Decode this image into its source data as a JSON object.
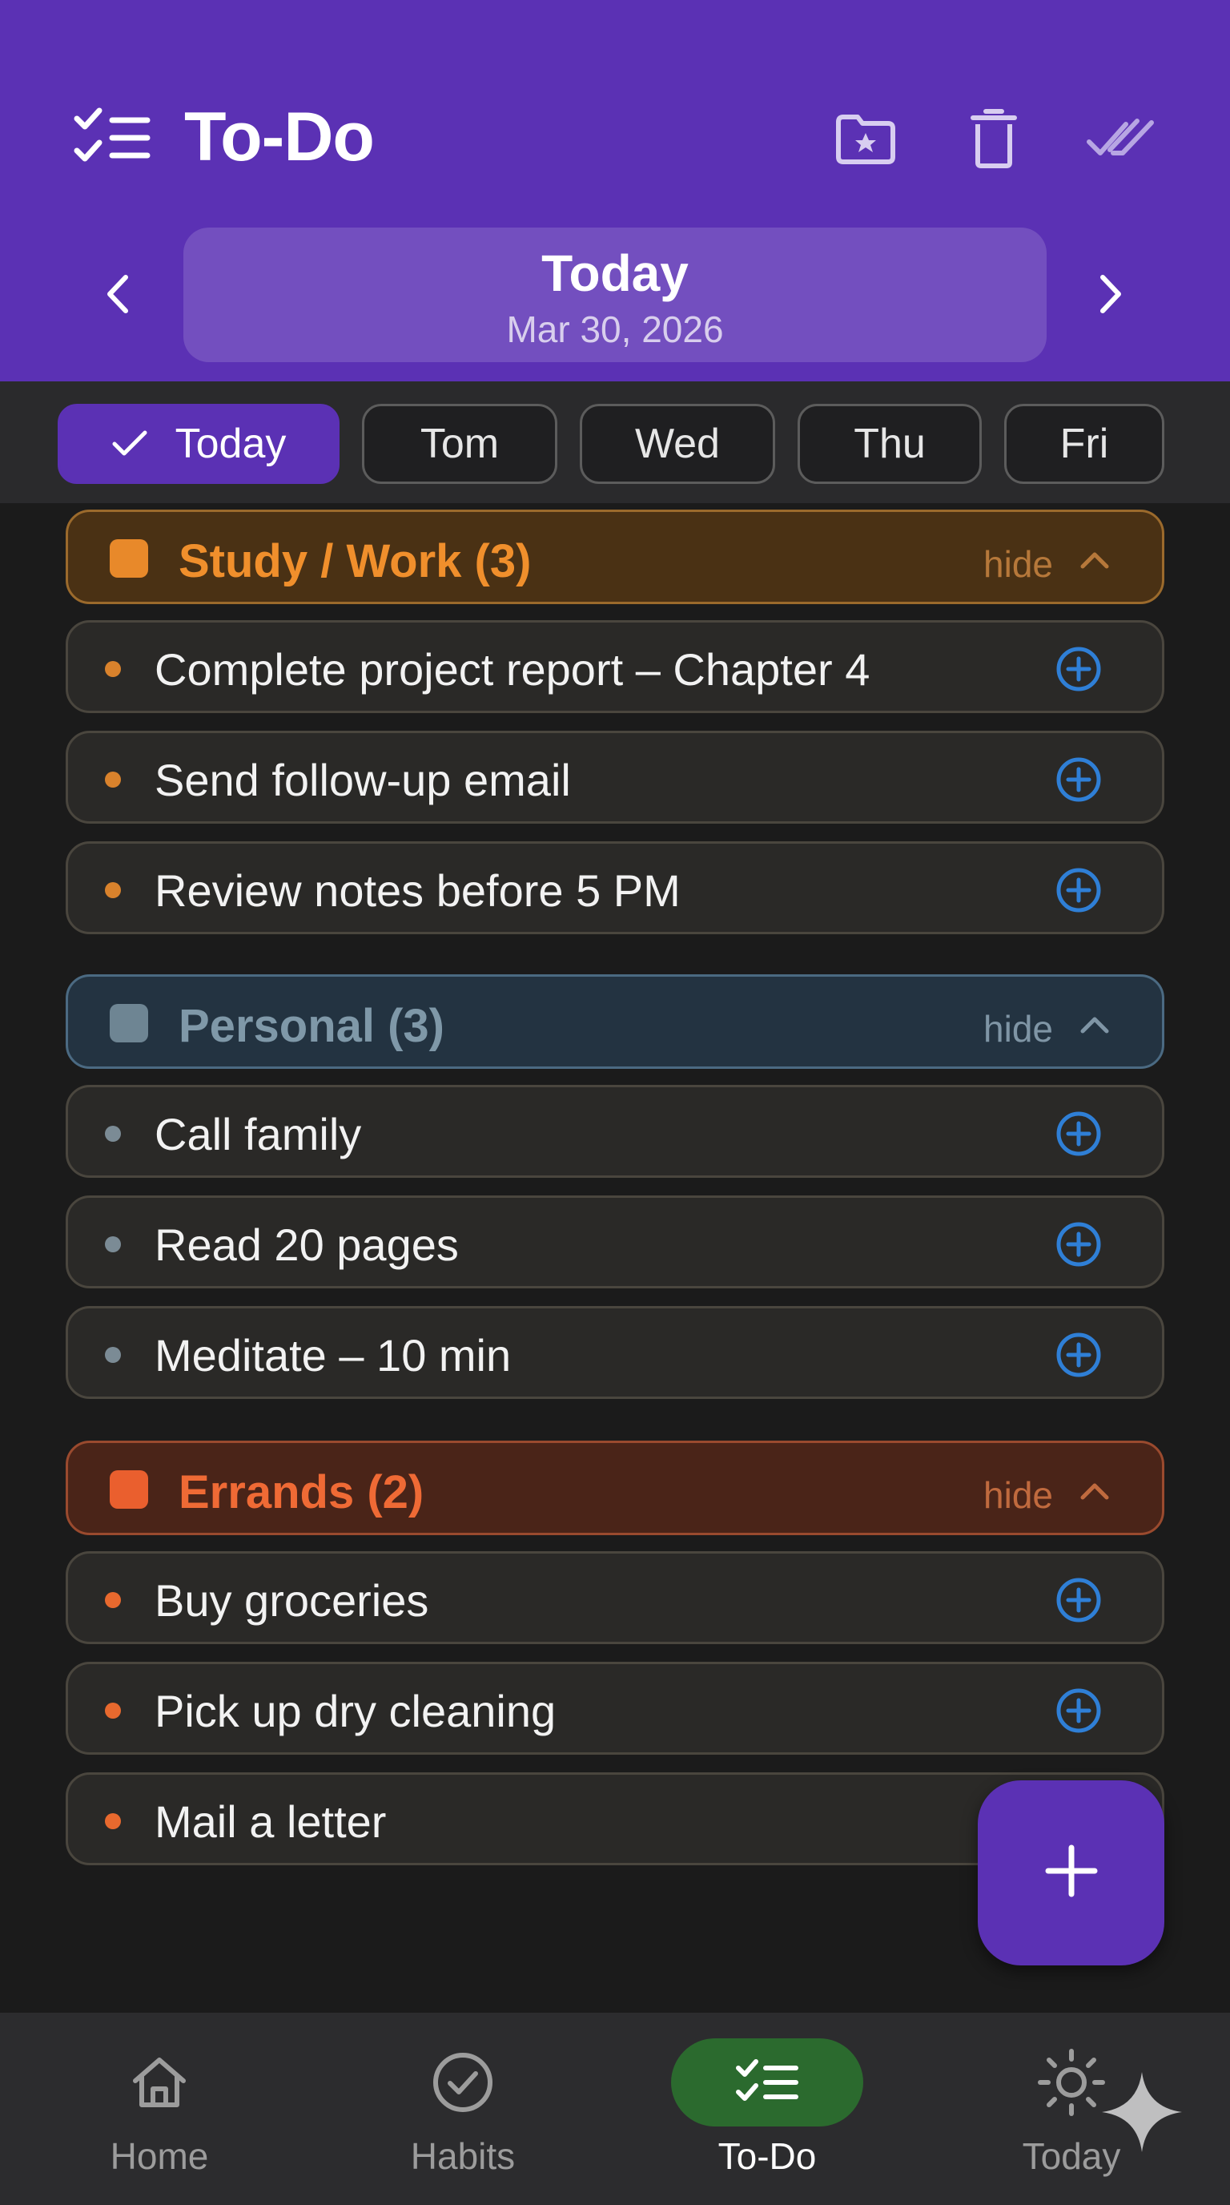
{
  "header": {
    "title": "To-Do",
    "date_label": "Today",
    "date_sub": "Mar 30, 2026",
    "actions": [
      "starred-folder-icon",
      "trash-icon",
      "mark-all-done-icon"
    ]
  },
  "days": [
    {
      "label": "Today",
      "active": true
    },
    {
      "label": "Tom",
      "active": false
    },
    {
      "label": "Wed",
      "active": false
    },
    {
      "label": "Thu",
      "active": false
    },
    {
      "label": "Fri",
      "active": false
    }
  ],
  "groups": [
    {
      "title": "Study / Work (3)",
      "hide_label": "hide",
      "color": "#e8892a",
      "tasks": [
        "Complete project report – Chapter 4",
        "Send follow-up email",
        "Review notes before 5 PM"
      ]
    },
    {
      "title": "Personal (3)",
      "hide_label": "hide",
      "color": "#6e8593",
      "tasks": [
        "Call family",
        "Read 20 pages",
        "Meditate – 10 min"
      ]
    },
    {
      "title": "Errands (2)",
      "hide_label": "hide",
      "color": "#ea5f2e",
      "tasks": [
        "Buy groceries",
        "Pick up dry cleaning",
        "Mail a letter"
      ]
    }
  ],
  "bottom_nav": [
    {
      "label": "Home",
      "icon": "home-icon",
      "active": false
    },
    {
      "label": "Habits",
      "icon": "check-circle-icon",
      "active": false
    },
    {
      "label": "To-Do",
      "icon": "checklist-icon",
      "active": true
    },
    {
      "label": "Today",
      "icon": "sun-icon",
      "active": false
    }
  ],
  "colors": {
    "primary": "#5b31b4",
    "active_nav": "#2b6a2e",
    "add_icon": "#2f7fd6"
  }
}
